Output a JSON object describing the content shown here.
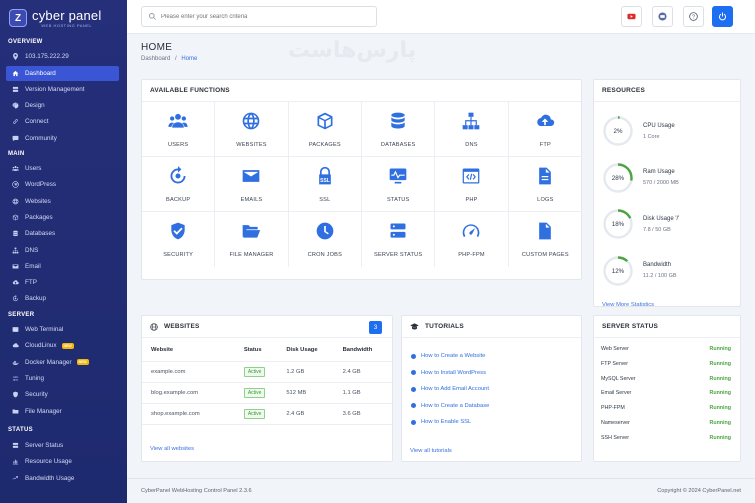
{
  "brand": {
    "title": "cyber panel",
    "subtitle": "WEB HOSTING PANEL",
    "logo_letter": "Z"
  },
  "sidebar": {
    "overview_label": "OVERVIEW",
    "ip": "103.175.222.29",
    "overview_items": [
      {
        "label": "Dashboard",
        "icon": "home-icon"
      },
      {
        "label": "Version Management",
        "icon": "server-icon"
      },
      {
        "label": "Design",
        "icon": "paint-icon"
      },
      {
        "label": "Connect",
        "icon": "link-icon"
      },
      {
        "label": "Community",
        "icon": "chat-icon"
      }
    ],
    "main_label": "MAIN",
    "main_items": [
      {
        "label": "Users",
        "icon": "users-icon"
      },
      {
        "label": "WordPress",
        "icon": "wordpress-icon"
      },
      {
        "label": "Websites",
        "icon": "globe-icon"
      },
      {
        "label": "Packages",
        "icon": "box-icon"
      },
      {
        "label": "Databases",
        "icon": "database-icon"
      },
      {
        "label": "DNS",
        "icon": "network-icon"
      },
      {
        "label": "Email",
        "icon": "mail-icon"
      },
      {
        "label": "FTP",
        "icon": "cloud-upload-icon"
      },
      {
        "label": "Backup",
        "icon": "backup-icon"
      }
    ],
    "server_label": "SERVER",
    "server_items": [
      {
        "label": "Web Terminal",
        "icon": "terminal-icon"
      },
      {
        "label": "CloudLinux",
        "icon": "cloud-icon",
        "badge": "NEW"
      },
      {
        "label": "Docker Manager",
        "icon": "docker-icon",
        "badge": "NEW"
      },
      {
        "label": "Tuning",
        "icon": "tune-icon"
      },
      {
        "label": "Security",
        "icon": "shield-icon"
      },
      {
        "label": "File Manager",
        "icon": "folder-icon"
      }
    ],
    "status_label": "STATUS",
    "status_items": [
      {
        "label": "Server Status",
        "icon": "server-status-icon"
      },
      {
        "label": "Resource Usage",
        "icon": "chart-icon"
      },
      {
        "label": "Bandwidth Usage",
        "icon": "bandwidth-icon"
      }
    ]
  },
  "search": {
    "placeholder": "Please enter your search criteria"
  },
  "page": {
    "title": "HOME",
    "crumb_root": "Dashboard",
    "crumb_sep": "/",
    "crumb_current": "Home",
    "watermark": "پارس‌هاست"
  },
  "functions": {
    "title": "AVAILABLE FUNCTIONS",
    "items": [
      {
        "label": "USERS",
        "icon": "users-icon"
      },
      {
        "label": "WEBSITES",
        "icon": "globe-icon"
      },
      {
        "label": "PACKAGES",
        "icon": "box-icon"
      },
      {
        "label": "DATABASES",
        "icon": "database-icon"
      },
      {
        "label": "DNS",
        "icon": "network-icon"
      },
      {
        "label": "FTP",
        "icon": "cloud-upload-icon"
      },
      {
        "label": "BACKUP",
        "icon": "backup-icon"
      },
      {
        "label": "EMAILS",
        "icon": "mail-icon"
      },
      {
        "label": "SSL",
        "icon": "ssl-lock-icon"
      },
      {
        "label": "STATUS",
        "icon": "monitor-icon"
      },
      {
        "label": "PHP",
        "icon": "code-icon"
      },
      {
        "label": "LOGS",
        "icon": "document-icon"
      },
      {
        "label": "SECURITY",
        "icon": "shield-check-icon"
      },
      {
        "label": "FILE MANAGER",
        "icon": "folder-open-icon"
      },
      {
        "label": "CRON JOBS",
        "icon": "clock-icon"
      },
      {
        "label": "SERVER STATUS",
        "icon": "server-icon"
      },
      {
        "label": "PHP-FPM",
        "icon": "gauge-icon"
      },
      {
        "label": "CUSTOM PAGES",
        "icon": "page-icon"
      }
    ]
  },
  "resources": {
    "title": "RESOURCES",
    "items": [
      {
        "name": "CPU Usage",
        "value": "1 Core",
        "percent_label": "2%",
        "percent": 2
      },
      {
        "name": "Ram Usage",
        "value": "570 / 2000 MB",
        "percent_label": "28%",
        "percent": 28
      },
      {
        "name": "Disk Usage '/'",
        "value": "7.8 / 50 GB",
        "percent_label": "18%",
        "percent": 18
      },
      {
        "name": "Bandwidth",
        "value": "11.2 / 100 GB",
        "percent_label": "12%",
        "percent": 12
      }
    ],
    "link": "View More Statistics"
  },
  "websites": {
    "title": "WEBSITES",
    "count": "3",
    "columns": [
      "Website",
      "Status",
      "Disk Usage",
      "Bandwidth"
    ],
    "rows": [
      {
        "website": "example.com",
        "status": "Active",
        "disk": "1.2 GB",
        "bandwidth": "2.4 GB"
      },
      {
        "website": "blog.example.com",
        "status": "Active",
        "disk": "512 MB",
        "bandwidth": "1.1 GB"
      },
      {
        "website": "shop.example.com",
        "status": "Active",
        "disk": "2.4 GB",
        "bandwidth": "3.6 GB"
      }
    ],
    "link": "View all websites"
  },
  "tutorials": {
    "title": "TUTORIALS",
    "items": [
      "How to Create a Website",
      "How to Install WordPress",
      "How to Add Email Account",
      "How to Create a Database",
      "How to Enable SSL"
    ],
    "link": "View all tutorials"
  },
  "server_status": {
    "title": "SERVER STATUS",
    "items": [
      {
        "name": "Web Server",
        "state": "Running"
      },
      {
        "name": "FTP Server",
        "state": "Running"
      },
      {
        "name": "MySQL Server",
        "state": "Running"
      },
      {
        "name": "Email Server",
        "state": "Running"
      },
      {
        "name": "PHP-FPM",
        "state": "Running"
      },
      {
        "name": "Nameserver",
        "state": "Running"
      },
      {
        "name": "SSH Server",
        "state": "Running"
      }
    ]
  },
  "footer": {
    "left": "CyberPanel WebHosting Control Panel 2.3.6",
    "right": "Copyright © 2024 CyberPanel.net"
  },
  "colors": {
    "accent": "#1e6ef2",
    "sidebar": "#252f7a",
    "running": "#4aa541",
    "youtube": "#e02a2a"
  }
}
